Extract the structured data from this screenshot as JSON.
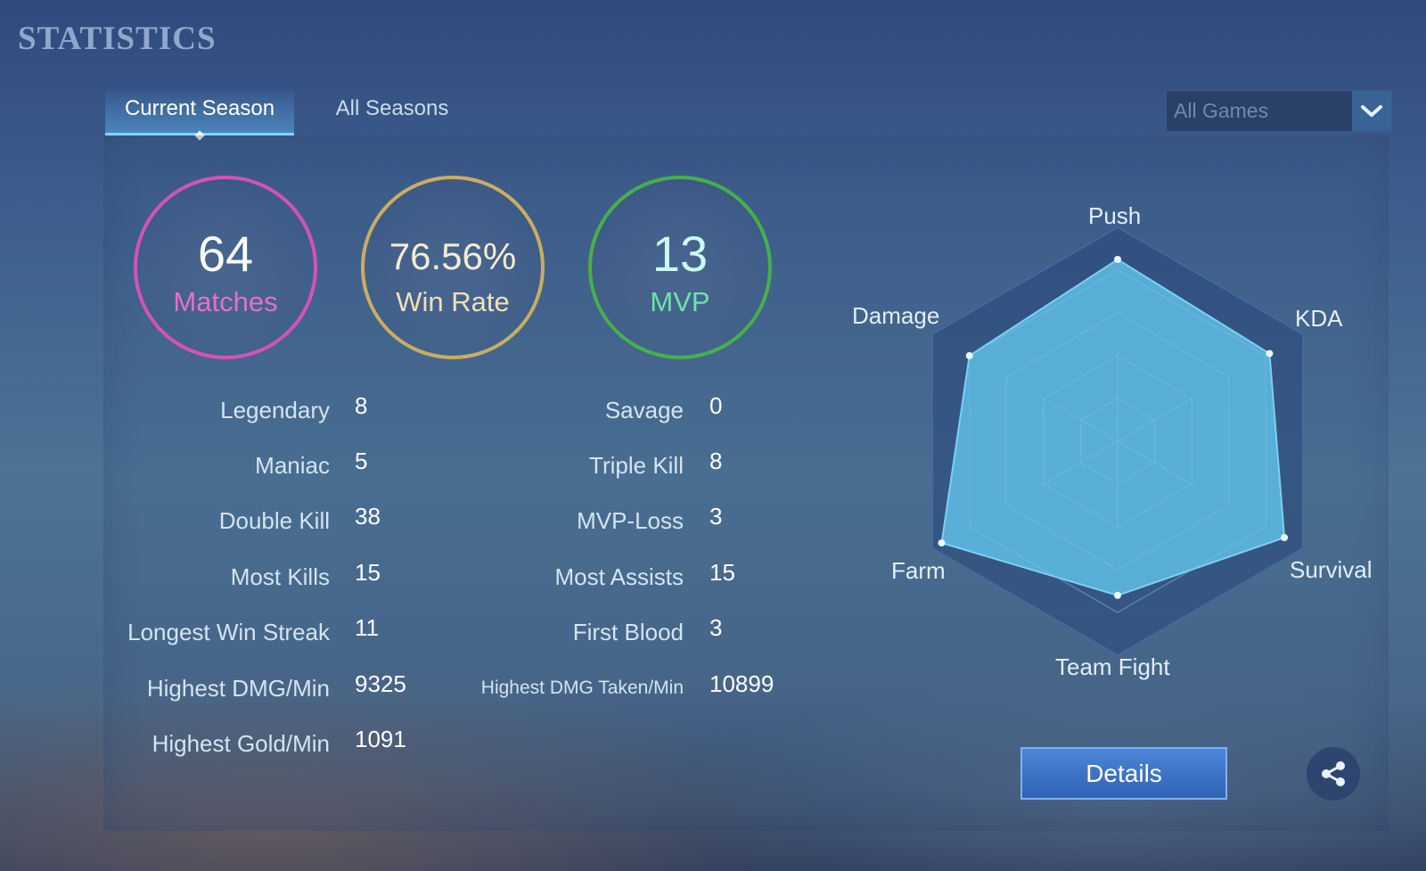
{
  "header": {
    "title": "STATISTICS"
  },
  "tabs": [
    {
      "label": "Current Season",
      "active": true
    },
    {
      "label": "All Seasons",
      "active": false
    }
  ],
  "filter": {
    "selected": "All Games"
  },
  "summary": {
    "matches": {
      "value": "64",
      "label": "Matches",
      "color": "#d452b8"
    },
    "win_rate": {
      "value": "76.56%",
      "label": "Win Rate",
      "color": "#c9ad62"
    },
    "mvp": {
      "value": "13",
      "label": "MVP",
      "color": "#46b04a"
    }
  },
  "stats_left": [
    {
      "label": "Legendary",
      "value": "8"
    },
    {
      "label": "Maniac",
      "value": "5"
    },
    {
      "label": "Double Kill",
      "value": "38"
    },
    {
      "label": "Most Kills",
      "value": "15"
    },
    {
      "label": "Longest Win Streak",
      "value": "11"
    },
    {
      "label": "Highest DMG/Min",
      "value": "9325"
    },
    {
      "label": "Highest Gold/Min",
      "value": "1091"
    }
  ],
  "stats_right": [
    {
      "label": "Savage",
      "value": "0"
    },
    {
      "label": "Triple Kill",
      "value": "8"
    },
    {
      "label": "MVP-Loss",
      "value": "3"
    },
    {
      "label": "Most Assists",
      "value": "15"
    },
    {
      "label": "First Blood",
      "value": "3"
    },
    {
      "label": "Highest DMG Taken/Min",
      "value": "10899"
    }
  ],
  "chart_data": {
    "type": "radar",
    "axes": [
      "Push",
      "KDA",
      "Survival",
      "Team Fight",
      "Farm",
      "Damage"
    ],
    "values": [
      0.85,
      0.82,
      0.9,
      0.72,
      0.95,
      0.8
    ],
    "range": [
      0,
      1
    ],
    "grid_levels": 4,
    "fill_color": "#5cb6de"
  },
  "actions": {
    "details_label": "Details"
  },
  "colors": {
    "accent": "#7fd6ff",
    "button": "#3a70c6"
  }
}
